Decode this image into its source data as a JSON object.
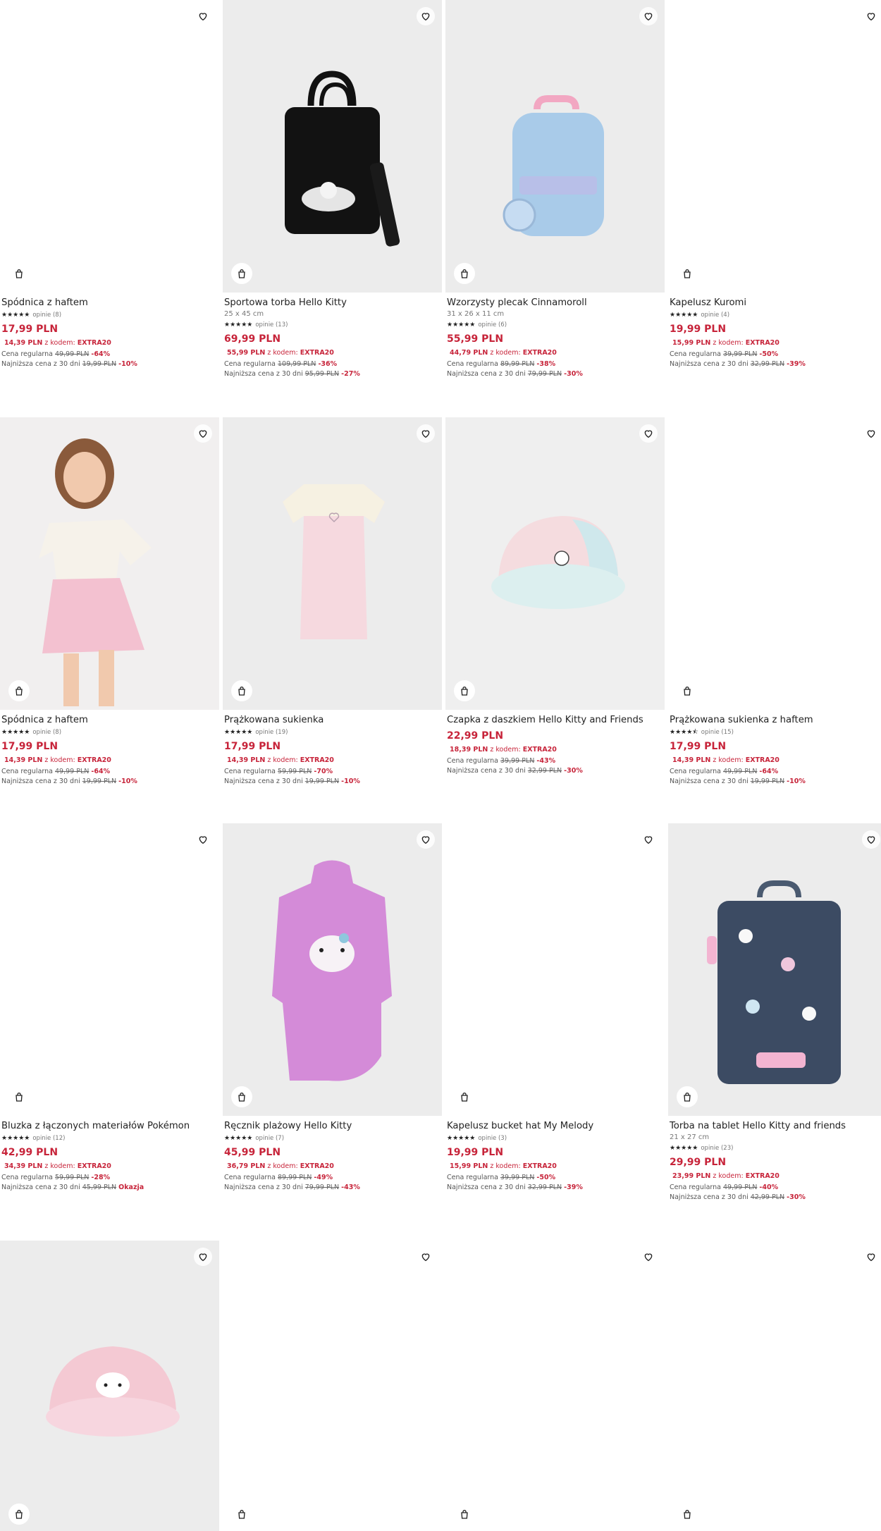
{
  "colors": {
    "accent": "#c7243a",
    "text": "#222222",
    "muted": "#777777"
  },
  "icons": {
    "favorite": "heart-icon",
    "add_to_cart": "shopping-bag-icon",
    "star": "star-icon"
  },
  "products": [
    {
      "name": "Spódnica z haftem",
      "stars": "★★★★★",
      "reviews": "opinie (8)",
      "price": "17,99 PLN",
      "code_price": "14,39 PLN",
      "code_label": "z kodem:",
      "code": "EXTRA20",
      "reg_label": "Cena regularna",
      "reg_price": "49,99 PLN",
      "reg_pct": "-64%",
      "low_label": "Najniższa cena z 30 dni",
      "low_price": "19,99 PLN",
      "low_pct": "-10%"
    },
    {
      "name": "Sportowa torba Hello Kitty",
      "dims": "25 x 45 cm",
      "stars": "★★★★★",
      "reviews": "opinie (13)",
      "price": "69,99 PLN",
      "code_price": "55,99 PLN",
      "code_label": "z kodem:",
      "code": "EXTRA20",
      "reg_label": "Cena regularna",
      "reg_price": "109,99 PLN",
      "reg_pct": "-36%",
      "low_label": "Najniższa cena z 30 dni",
      "low_price": "95,99 PLN",
      "low_pct": "-27%"
    },
    {
      "name": "Wzorzysty plecak Cinnamoroll",
      "dims": "31 x 26 x 11 cm",
      "stars": "★★★★★",
      "reviews": "opinie (6)",
      "price": "55,99 PLN",
      "code_price": "44,79 PLN",
      "code_label": "z kodem:",
      "code": "EXTRA20",
      "reg_label": "Cena regularna",
      "reg_price": "89,99 PLN",
      "reg_pct": "-38%",
      "low_label": "Najniższa cena z 30 dni",
      "low_price": "79,99 PLN",
      "low_pct": "-30%"
    },
    {
      "name": "Kapelusz Kuromi",
      "stars": "★★★★★",
      "reviews": "opinie (4)",
      "price": "19,99 PLN",
      "code_price": "15,99 PLN",
      "code_label": "z kodem:",
      "code": "EXTRA20",
      "reg_label": "Cena regularna",
      "reg_price": "39,99 PLN",
      "reg_pct": "-50%",
      "low_label": "Najniższa cena z 30 dni",
      "low_price": "32,99 PLN",
      "low_pct": "-39%"
    },
    {
      "name": "Spódnica z haftem",
      "stars": "★★★★★",
      "reviews": "opinie (8)",
      "price": "17,99 PLN",
      "code_price": "14,39 PLN",
      "code_label": "z kodem:",
      "code": "EXTRA20",
      "reg_label": "Cena regularna",
      "reg_price": "49,99 PLN",
      "reg_pct": "-64%",
      "low_label": "Najniższa cena z 30 dni",
      "low_price": "19,99 PLN",
      "low_pct": "-10%"
    },
    {
      "name": "Prążkowana sukienka",
      "stars": "★★★★★",
      "reviews": "opinie (19)",
      "price": "17,99 PLN",
      "code_price": "14,39 PLN",
      "code_label": "z kodem:",
      "code": "EXTRA20",
      "reg_label": "Cena regularna",
      "reg_price": "59,99 PLN",
      "reg_pct": "-70%",
      "low_label": "Najniższa cena z 30 dni",
      "low_price": "19,99 PLN",
      "low_pct": "-10%"
    },
    {
      "name": "Czapka z daszkiem Hello Kitty and Friends",
      "price": "22,99 PLN",
      "code_price": "18,39 PLN",
      "code_label": "z kodem:",
      "code": "EXTRA20",
      "reg_label": "Cena regularna",
      "reg_price": "39,99 PLN",
      "reg_pct": "-43%",
      "low_label": "Najniższa cena z 30 dni",
      "low_price": "32,99 PLN",
      "low_pct": "-30%"
    },
    {
      "name": "Prążkowana sukienka z haftem",
      "stars": "★★★★⯪",
      "reviews": "opinie (15)",
      "price": "17,99 PLN",
      "code_price": "14,39 PLN",
      "code_label": "z kodem:",
      "code": "EXTRA20",
      "reg_label": "Cena regularna",
      "reg_price": "49,99 PLN",
      "reg_pct": "-64%",
      "low_label": "Najniższa cena z 30 dni",
      "low_price": "19,99 PLN",
      "low_pct": "-10%"
    },
    {
      "name": "Bluzka z łączonych materiałów Pokémon",
      "stars": "★★★★★",
      "reviews": "opinie (12)",
      "price": "42,99 PLN",
      "code_price": "34,39 PLN",
      "code_label": "z kodem:",
      "code": "EXTRA20",
      "reg_label": "Cena regularna",
      "reg_price": "59,99 PLN",
      "reg_pct": "-28%",
      "low_label": "Najniższa cena z 30 dni",
      "low_price": "45,99 PLN",
      "low_pct": "Okazja"
    },
    {
      "name": "Ręcznik plażowy Hello Kitty",
      "stars": "★★★★★",
      "reviews": "opinie (7)",
      "price": "45,99 PLN",
      "code_price": "36,79 PLN",
      "code_label": "z kodem:",
      "code": "EXTRA20",
      "reg_label": "Cena regularna",
      "reg_price": "89,99 PLN",
      "reg_pct": "-49%",
      "low_label": "Najniższa cena z 30 dni",
      "low_price": "79,99 PLN",
      "low_pct": "-43%"
    },
    {
      "name": "Kapelusz bucket hat My Melody",
      "stars": "★★★★★",
      "reviews": "opinie (3)",
      "price": "19,99 PLN",
      "code_price": "15,99 PLN",
      "code_label": "z kodem:",
      "code": "EXTRA20",
      "reg_label": "Cena regularna",
      "reg_price": "39,99 PLN",
      "reg_pct": "-50%",
      "low_label": "Najniższa cena z 30 dni",
      "low_price": "32,99 PLN",
      "low_pct": "-39%"
    },
    {
      "name": "Torba na tablet Hello Kitty and friends",
      "dims": "21 x 27 cm",
      "stars": "★★★★★",
      "reviews": "opinie (23)",
      "price": "29,99 PLN",
      "code_price": "23,99 PLN",
      "code_label": "z kodem:",
      "code": "EXTRA20",
      "reg_label": "Cena regularna",
      "reg_price": "49,99 PLN",
      "reg_pct": "-40%",
      "low_label": "Najniższa cena z 30 dni",
      "low_price": "42,99 PLN",
      "low_pct": "-30%"
    }
  ]
}
